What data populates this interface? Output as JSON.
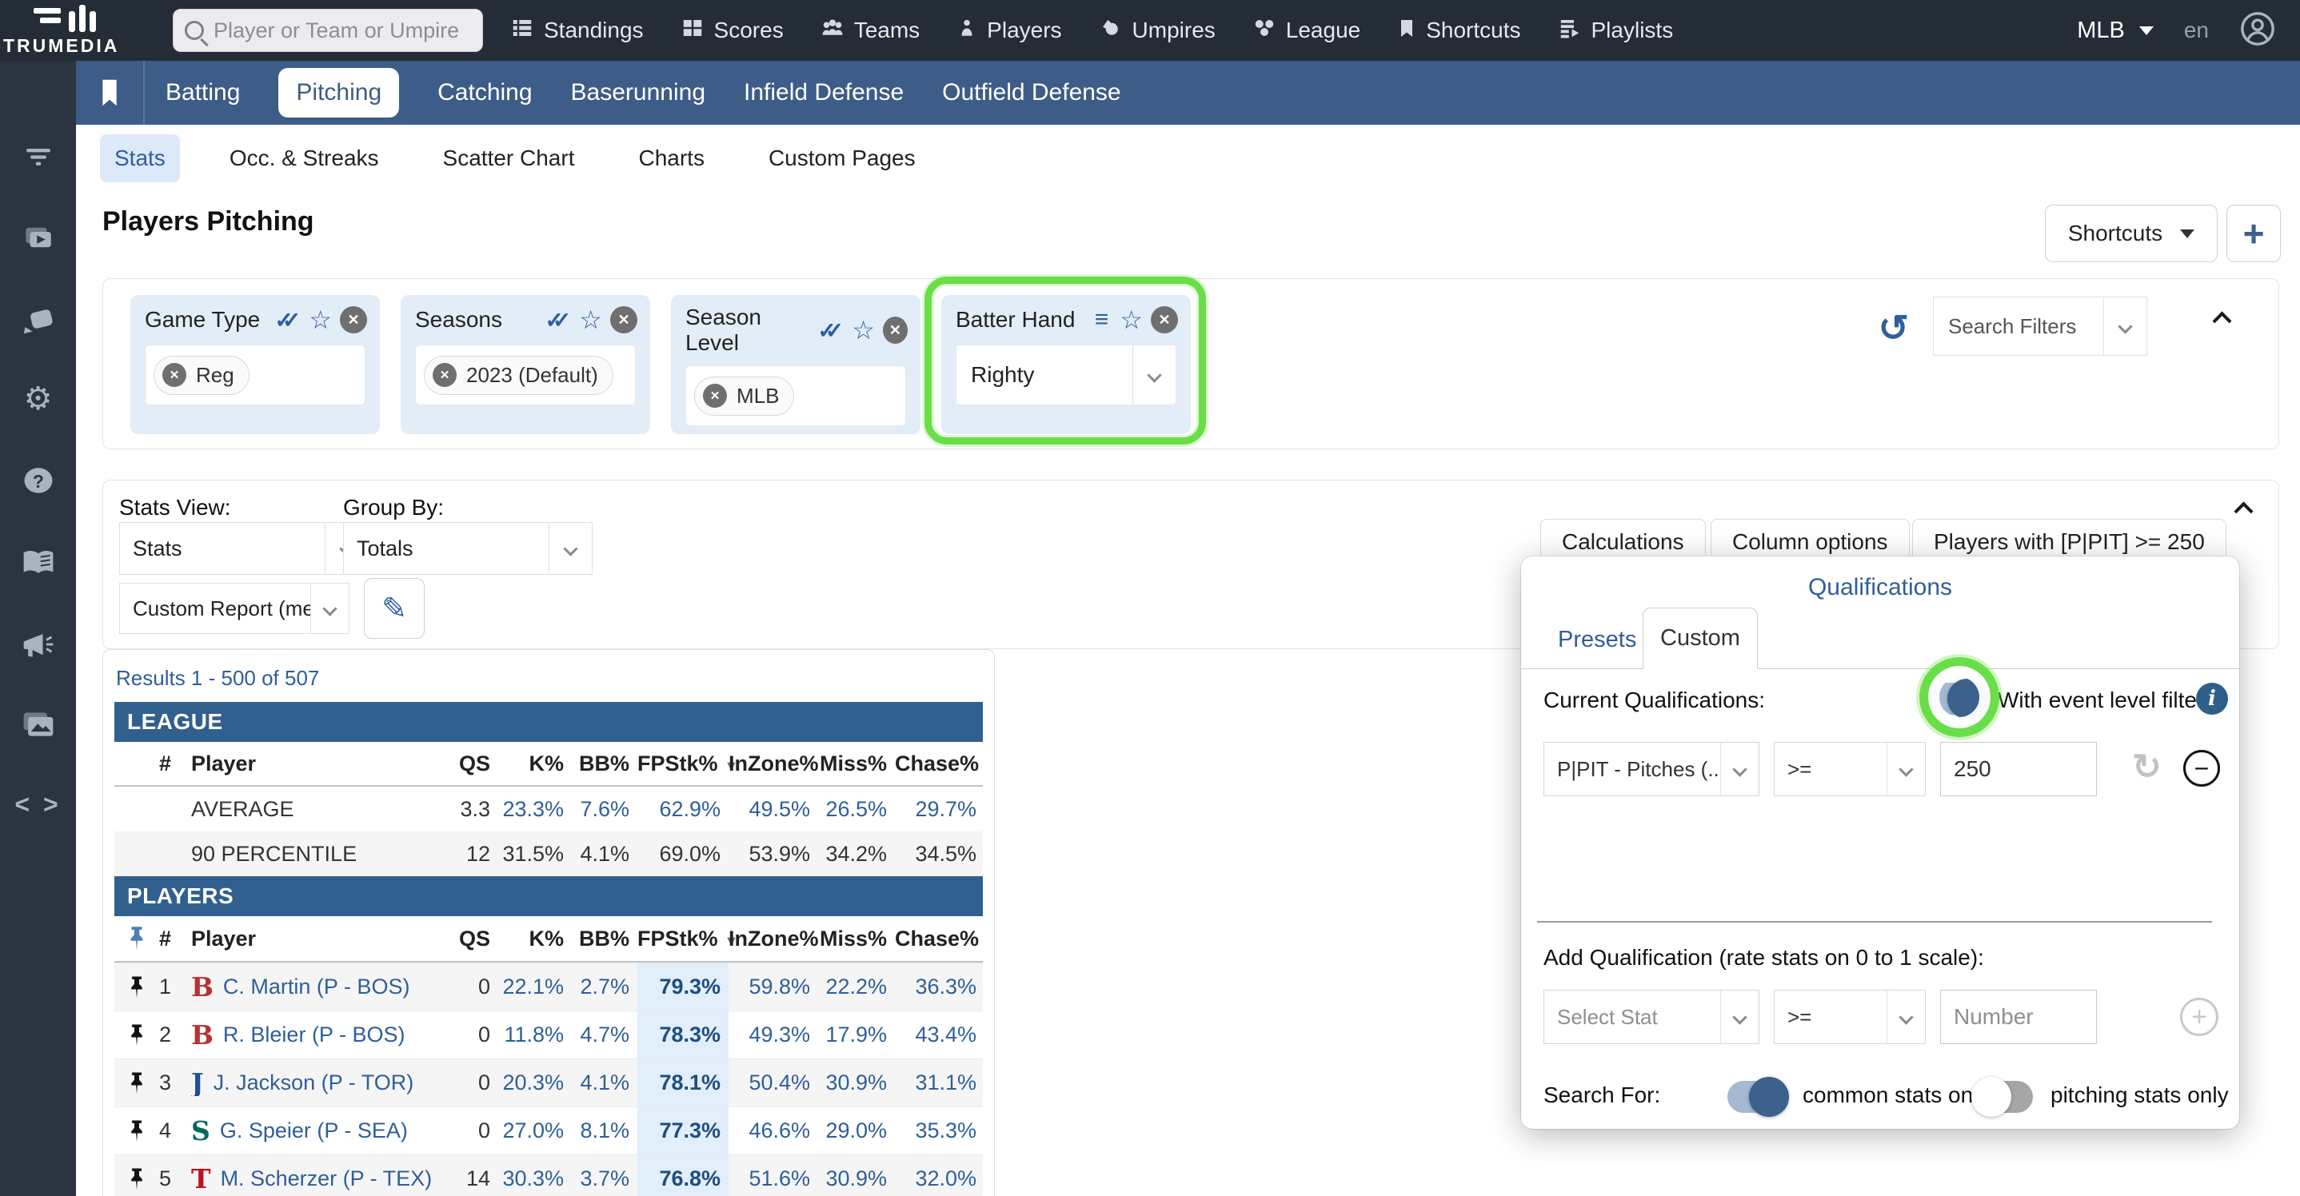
{
  "colors": {
    "nav_dark": "#242c36",
    "sidebar_dark": "#2b3440",
    "bar_blue": "#3d5c87",
    "accent_blue": "#2e5f99",
    "section_header_blue": "#31608e",
    "fpstk_highlight": "#e2eef9",
    "annotation_green": "#6ade48",
    "toggle_on_blue": "#3b618c"
  },
  "topnav": {
    "brand": "TRUMEDIA",
    "search_placeholder": "Player or Team or Umpire",
    "items": [
      "Standings",
      "Scores",
      "Teams",
      "Players",
      "Umpires",
      "League",
      "Shortcuts",
      "Playlists"
    ],
    "league_selector": "MLB",
    "locale": "en"
  },
  "nav": {
    "tabs": [
      "Batting",
      "Pitching",
      "Catching",
      "Baserunning",
      "Infield Defense",
      "Outfield Defense"
    ],
    "active": "Pitching"
  },
  "subnav": {
    "tabs": [
      "Stats",
      "Occ. & Streaks",
      "Scatter Chart",
      "Charts",
      "Custom Pages"
    ],
    "active": "Stats"
  },
  "page": {
    "title": "Players Pitching",
    "shortcuts_label": "Shortcuts",
    "add_label": "+"
  },
  "filters": {
    "chips": [
      {
        "label": "Game Type",
        "token": "Reg"
      },
      {
        "label": "Seasons",
        "token": "2023 (Default)"
      },
      {
        "label": "Season Level",
        "token": "MLB"
      },
      {
        "label": "Batter Hand",
        "value": "Righty"
      }
    ],
    "search_filters_placeholder": "Search Filters"
  },
  "settings": {
    "stats_view_label": "Stats View:",
    "stats_view_value": "Stats",
    "group_by_label": "Group By:",
    "group_by_value": "Totals",
    "report_value": "Custom Report (me)",
    "calculations_label": "Calculations",
    "column_options_label": "Column options",
    "players_with_label": "Players with [P|PIT] >= 250"
  },
  "table": {
    "results_label": "Results 1 - 500 of 507",
    "league_section": "LEAGUE",
    "players_section": "PLAYERS",
    "columns": {
      "rank": "#",
      "player": "Player",
      "qs": "QS",
      "k": "K%",
      "bb": "BB%",
      "fpstk": "FPStk%",
      "inzone": "InZone%",
      "miss": "Miss%",
      "chase": "Chase%"
    },
    "league_rows": [
      {
        "name": "AVERAGE",
        "qs": "3.3",
        "k": "23.3%",
        "bb": "7.6%",
        "fpstk": "62.9%",
        "inzone": "49.5%",
        "miss": "26.5%",
        "chase": "29.7%"
      },
      {
        "name": "90 PERCENTILE",
        "qs": "12",
        "k": "31.5%",
        "bb": "4.1%",
        "fpstk": "69.0%",
        "inzone": "53.9%",
        "miss": "34.2%",
        "chase": "34.5%"
      }
    ],
    "player_rows": [
      {
        "rank": "1",
        "logo": "B",
        "logo_color": "#b5322f",
        "name": "C. Martin (P - BOS)",
        "qs": "0",
        "k": "22.1%",
        "bb": "2.7%",
        "fpstk": "79.3%",
        "inzone": "59.8%",
        "miss": "22.2%",
        "chase": "36.3%"
      },
      {
        "rank": "2",
        "logo": "B",
        "logo_color": "#b5322f",
        "name": "R. Bleier (P - BOS)",
        "qs": "0",
        "k": "11.8%",
        "bb": "4.7%",
        "fpstk": "78.3%",
        "inzone": "49.3%",
        "miss": "17.9%",
        "chase": "43.4%"
      },
      {
        "rank": "3",
        "logo": "J",
        "logo_color": "#1d4f91",
        "name": "J. Jackson (P - TOR)",
        "qs": "0",
        "k": "20.3%",
        "bb": "4.1%",
        "fpstk": "78.1%",
        "inzone": "50.4%",
        "miss": "30.9%",
        "chase": "31.1%"
      },
      {
        "rank": "4",
        "logo": "S",
        "logo_color": "#00685e",
        "name": "G. Speier (P - SEA)",
        "qs": "0",
        "k": "27.0%",
        "bb": "8.1%",
        "fpstk": "77.3%",
        "inzone": "46.6%",
        "miss": "29.0%",
        "chase": "35.3%"
      },
      {
        "rank": "5",
        "logo": "T",
        "logo_color": "#c0111f",
        "name": "M. Scherzer (P - TEX)",
        "qs": "14",
        "k": "30.3%",
        "bb": "3.7%",
        "fpstk": "76.8%",
        "inzone": "51.6%",
        "miss": "30.9%",
        "chase": "32.0%"
      }
    ]
  },
  "qualifications": {
    "title": "Qualifications",
    "presets_tab": "Presets",
    "custom_tab": "Custom",
    "current_label": "Current Qualifications:",
    "event_filter_label": "With event level filters",
    "rule": {
      "stat": "P|PIT - Pitches (...",
      "op": ">=",
      "value": "250"
    },
    "add_label": "Add Qualification (rate stats on 0 to 1 scale):",
    "add_rule": {
      "stat_placeholder": "Select Stat",
      "op": ">=",
      "value_placeholder": "Number"
    },
    "search_for_label": "Search For:",
    "common_toggle_label": "common stats only",
    "pitching_toggle_label": "pitching stats only"
  }
}
